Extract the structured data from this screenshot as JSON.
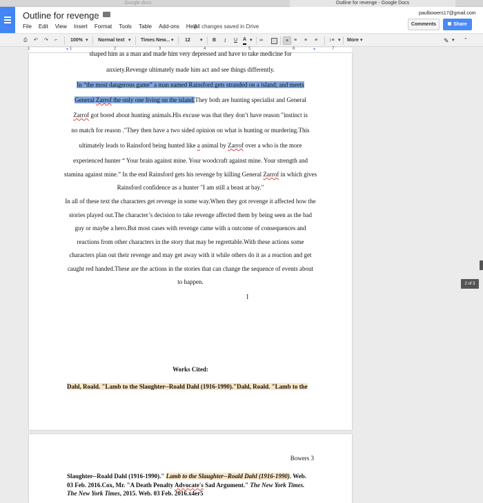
{
  "browser": {
    "tab_left": "Google docs",
    "tab_right": "Outline for revenge - Google Docs"
  },
  "header": {
    "title": "Outline for revenge",
    "menu": [
      "File",
      "Edit",
      "View",
      "Insert",
      "Format",
      "Tools",
      "Table",
      "Add-ons",
      "Help"
    ],
    "saved_status": "All changes saved in Drive",
    "user_email": "paulbowers17@gmail.com",
    "comments_label": "Comments",
    "share_label": "Share"
  },
  "toolbar": {
    "zoom": "100%",
    "style": "Normal text",
    "font": "Times New...",
    "size": "12",
    "bold": "B",
    "italic": "I",
    "underline": "U",
    "text_color": "A",
    "more": "More"
  },
  "ruler": [
    "1",
    "1",
    "2",
    "3",
    "4",
    "5",
    "6",
    "7"
  ],
  "document": {
    "paragraph1": [
      "shaped him as a man and made him very depressed and have to take medicine for",
      "anxiety.Revenge ultimately made him act and see things differently."
    ],
    "paragraph2": {
      "line1_highlight": "In “the most dangerous game” a man named Rainsford gets stranded on a island; and meets",
      "line2_highlight_a": "General ",
      "line2_highlight_b": "Zarrof",
      "line2_highlight_c": " the only one living on the island.",
      "line2_rest": "They both are hunting specialist and General",
      "line3_a": "Zarrof",
      "line3_b": " got bored about hunting animals.His excuse was that they don’t have reason \"instinct is",
      "line4": "no match for reason .\"They then have a two sided opinion on what is hunting or murdering.This",
      "line5_a": "ultimately leads to Rainsford being hunted like ",
      "line5_b": "a",
      "line5_c": " animal by ",
      "line5_d": "Zarrof",
      "line5_e": " over a who is the more",
      "line6": "experienced hunter “ Your brain against mine. Your woodcraft against mine. Your strength and",
      "line7_a": "stamina against mine.” In the end Rainsford gets his revenge by killing General ",
      "line7_b": "Zarrof",
      "line7_c": " in which gives",
      "line8": "Rainsford confidence as a hunter  \"I am still a beast at bay.\""
    },
    "paragraph3": [
      "In all of these text the characters get revenge in some way.When they got revenge it affected how the",
      "stories played out.The character’s decision to take revenge affected them by being seen as the bad",
      "guy or maybe a hero.But most cases with revenge came with a outcome of  consequences and",
      "reactions from other characters in the story that may be regrettable.With these actions some",
      "characters plan out their revenge and may get away with it while others do it as a reaction and get",
      "caught red handed.These are the actions in the stories that can change the sequence of events about",
      "to happen."
    ],
    "works_cited_title": "Works Cited:",
    "citation1": "Dahl, Roald. \"Lamb to the Slaughter--Roald Dahl (1916-1990).\"Dahl, Roald. \"Lamb to the",
    "page2_header": "Bowers 3",
    "citation2_a": "Slaughter--Roald Dahl (1916-1990).\" ",
    "citation2_b": "Lamb to the Slaughter--Roald Dahl (1916-1990)",
    "citation2_c": ". Web.",
    "citation3_a": "03 Feb. 2016.Cox, Mr. \"A Death Penalty ",
    "citation3_b": "Advocate's",
    "citation3_c": " Sad Argument.\" ",
    "citation3_d": "The New York Times.",
    "citation4_a": "The New York Times",
    "citation4_b": ", 2015. Web. 03 Feb. 2016.x4er5"
  },
  "page_indicator": "2 of 3",
  "cursor_glyph": "I"
}
